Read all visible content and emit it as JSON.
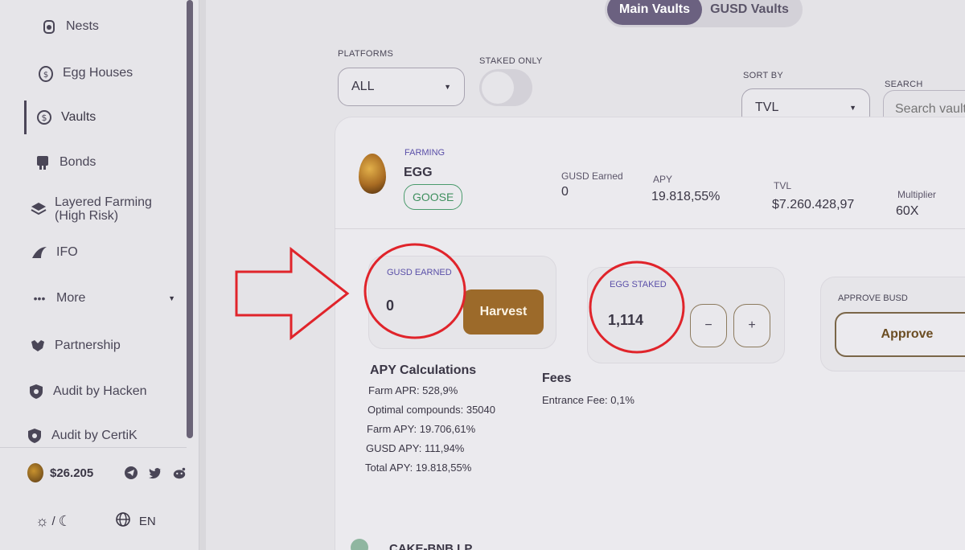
{
  "sidebar": {
    "items": [
      {
        "label": "Nests",
        "icon": "nest-icon"
      },
      {
        "label": "Egg Houses",
        "icon": "egg-house-icon"
      },
      {
        "label": "Vaults",
        "icon": "vault-icon"
      },
      {
        "label": "Bonds",
        "icon": "bonds-icon"
      },
      {
        "label": "Layered Farming (High Risk)",
        "icon": "layers-icon"
      },
      {
        "label": "IFO",
        "icon": "ifo-icon"
      },
      {
        "label": "More",
        "icon": "more-icon"
      },
      {
        "label": "Partnership",
        "icon": "partnership-icon"
      },
      {
        "label": "Audit by Hacken",
        "icon": "shield-icon"
      },
      {
        "label": "Audit by CertiK",
        "icon": "shield-icon"
      }
    ],
    "price": "$26.205",
    "theme_separator": "/",
    "language": "EN"
  },
  "tabs": [
    {
      "label": "Main Vaults",
      "active": true
    },
    {
      "label": "GUSD Vaults",
      "active": false
    }
  ],
  "filters": {
    "platforms_label": "PLATFORMS",
    "platforms_value": "ALL",
    "staked_only_label": "STAKED ONLY",
    "sort_by_label": "SORT BY",
    "sort_by_value": "TVL",
    "search_label": "SEARCH",
    "search_placeholder": "Search vaults"
  },
  "vault": {
    "category": "FARMING",
    "name": "EGG",
    "tag": "GOOSE",
    "gusd_earned_label": "GUSD Earned",
    "gusd_earned_value": "0",
    "apy_label": "APY",
    "apy_value": "19.818,55%",
    "tvl_label": "TVL",
    "tvl_value": "$7.260.428,97",
    "multiplier_label": "Multiplier",
    "multiplier_value": "60X",
    "earned_panel_label": "GUSD EARNED",
    "earned_panel_value": "0",
    "harvest_label": "Harvest",
    "staked_panel_label": "EGG STAKED",
    "staked_panel_value": "1,114",
    "minus_label": "−",
    "plus_label": "+",
    "approve_panel_label": "APPROVE BUSD",
    "approve_label": "Approve",
    "apy_calc_title": "APY Calculations",
    "farm_apr": "Farm APR: 528,9%",
    "optimal_compounds": "Optimal compounds: 35040",
    "farm_apy": "Farm APY: 19.706,61%",
    "gusd_apy": "GUSD APY: 111,94%",
    "total_apy": "Total APY: 19.818,55%",
    "fees_title": "Fees",
    "entrance_fee": "Entrance Fee: 0,1%"
  },
  "next_vault": {
    "name": "CAKE-BNB LP"
  },
  "colors": {
    "accent_purple": "#6b6180",
    "harvest_brown": "#9c6a2a",
    "goose_green": "#3f8f5e",
    "annotation_red": "#e0242b"
  }
}
